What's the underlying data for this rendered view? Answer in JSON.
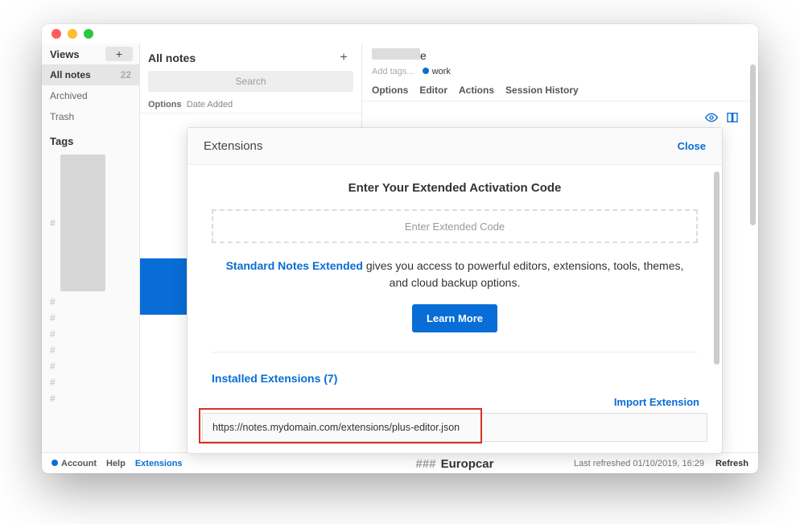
{
  "sidebar": {
    "views_label": "Views",
    "all_notes_label": "All notes",
    "all_notes_count": "22",
    "archived_label": "Archived",
    "trash_label": "Trash",
    "tags_label": "Tags"
  },
  "middle": {
    "title": "All notes",
    "search_placeholder": "Search",
    "options_label": "Options",
    "date_added_label": "Date Added"
  },
  "note": {
    "title_suffix": "e",
    "add_tags_label": "Add tags...",
    "work_tag": "work",
    "tabs": {
      "options": "Options",
      "editor": "Editor",
      "actions": "Actions",
      "session": "Session History"
    }
  },
  "modal": {
    "title": "Extensions",
    "close": "Close",
    "enter_title": "Enter Your Extended Activation Code",
    "code_placeholder": "Enter Extended Code",
    "sn_link": "Standard Notes Extended",
    "desc_rest": " gives you access to powerful editors, extensions, tools, themes, and cloud backup options.",
    "learn_more": "Learn More",
    "installed": "Installed Extensions (7)",
    "import": "Import Extension",
    "url_value": "https://notes.mydomain.com/extensions/plus-editor.json"
  },
  "peek": {
    "hashes": "###",
    "title": "Europcar"
  },
  "footer": {
    "account": "Account",
    "help": "Help",
    "extensions": "Extensions",
    "last_refreshed": "Last refreshed 01/10/2019, 16:29",
    "refresh": "Refresh"
  }
}
